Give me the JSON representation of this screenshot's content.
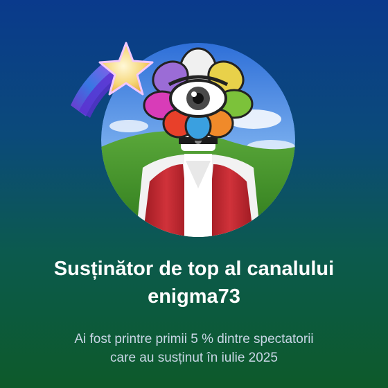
{
  "badge": {
    "icon": "star-icon"
  },
  "avatar": {
    "icon": "flower-eye-avatar-icon"
  },
  "title": {
    "line1": "Susținător de top al canalului",
    "line2": "enigma73"
  },
  "subtitle": {
    "line1": "Ai fost printre primii 5 % dintre spectatorii",
    "line2": "care au susținut în iulie 2025"
  },
  "colors": {
    "background_top": "#0a3a8c",
    "background_bottom": "#0d5a2a",
    "title": "#ffffff",
    "subtitle": "#c9d6e6"
  }
}
